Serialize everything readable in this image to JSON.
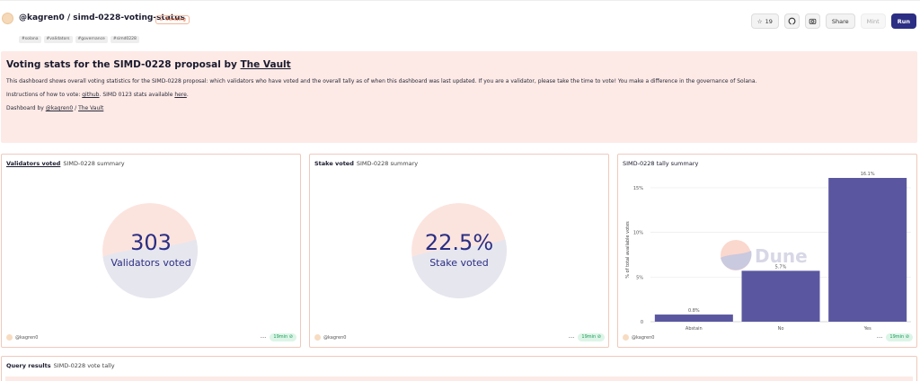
{
  "header": {
    "title": "@kagren0 / simd-0228-voting-status",
    "trending": "Trending",
    "tags": [
      "#solana",
      "#validators",
      "#governance",
      "#simd0228"
    ],
    "stars": "19",
    "share_label": "Share",
    "mint_label": "Mint",
    "run_label": "Run"
  },
  "intro": {
    "title_prefix": "Voting stats for the SIMD-0228 proposal by ",
    "title_link": "The Vault",
    "line1": "This dashboard shows overall voting statistics for the SIMD-0228 proposal: which validators who have voted and the overall tally as of when this dashboard was last updated. If you are a validator, please take the time to vote! You make a difference in the governance of Solana.",
    "line2_prefix": "Instructions of how to vote: ",
    "line2_link1": "github",
    "line2_middle": ". SIMD 0123 stats available ",
    "line2_link2": "here",
    "line2_suffix": ".",
    "line3_prefix": "Dashboard by ",
    "line3_link1": "@kagren0",
    "line3_sep": " / ",
    "line3_link2": "The Vault"
  },
  "cards": [
    {
      "head": "Validators voted",
      "sub": "SIMD-0228 summary",
      "value": "303",
      "label": "Validators voted",
      "user": "@kagren0",
      "freshness": "19min"
    },
    {
      "head": "Stake voted",
      "sub": "SIMD-0228 summary",
      "value": "22.5%",
      "label": "Stake voted",
      "user": "@kagren0",
      "freshness": "19min"
    },
    {
      "head": "SIMD-0228 tally summary",
      "user": "@kagren0",
      "freshness": "19min"
    }
  ],
  "watermark": "Dune",
  "colors": {
    "accent": "#2b2e83",
    "bar": "#5a57a0",
    "panel_bg": "#fdeae6",
    "card_border": "#f0c9bc",
    "fresh_green": "#1f9a5b"
  },
  "query": {
    "head": "Query results",
    "sub": "SIMD-0228 vote tally"
  },
  "chart_data": {
    "type": "bar",
    "title": "SIMD-0228 tally summary",
    "ylabel": "% of total available votes",
    "xlabel": "",
    "categories": [
      "Abstain",
      "No",
      "Yes"
    ],
    "values": [
      0.8,
      5.7,
      16.1
    ],
    "value_labels": [
      "0.8%",
      "5.7%",
      "16.1%"
    ],
    "yticks": [
      0,
      5,
      10,
      15
    ],
    "ytick_labels": [
      "0",
      "5%",
      "10%",
      "15%"
    ],
    "ylim": [
      0,
      16.1
    ],
    "grid": true
  }
}
